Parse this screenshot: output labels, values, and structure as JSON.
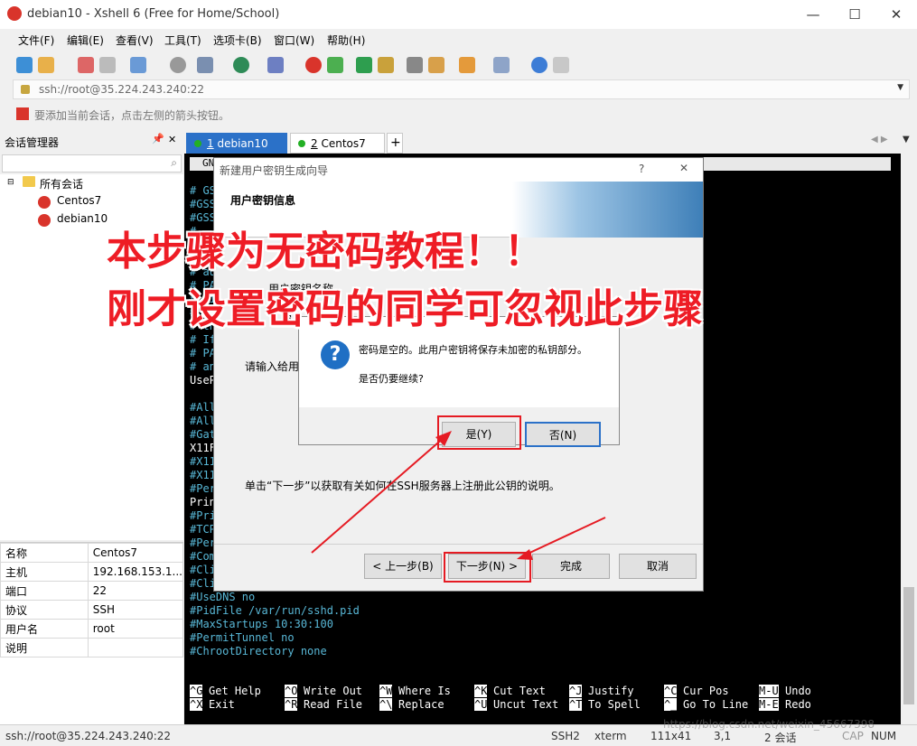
{
  "window": {
    "title": "debian10 - Xshell 6 (Free for Home/School)",
    "minimize": "—",
    "maximize": "☐",
    "close": "✕"
  },
  "menu": [
    "文件(F)",
    "编辑(E)",
    "查看(V)",
    "工具(T)",
    "选项卡(B)",
    "窗口(W)",
    "帮助(H)"
  ],
  "address": {
    "value": "ssh://root@35.224.243.240:22"
  },
  "hint": {
    "text": "要添加当前会话，点击左侧的箭头按钮。"
  },
  "sessions": {
    "header": "会话管理器",
    "pin": "ᅟ",
    "close": "✕",
    "root": "所有会话",
    "items": [
      "Centos7",
      "debian10"
    ]
  },
  "properties": [
    {
      "k": "名称",
      "v": "Centos7"
    },
    {
      "k": "主机",
      "v": "192.168.153.1..."
    },
    {
      "k": "端口",
      "v": "22"
    },
    {
      "k": "协议",
      "v": "SSH"
    },
    {
      "k": "用户名",
      "v": "root"
    },
    {
      "k": "说明",
      "v": ""
    }
  ],
  "tabs": [
    {
      "num": "1",
      "label": "debian10"
    },
    {
      "num": "2",
      "label": "Centos7"
    }
  ],
  "terminal": {
    "header": "GN",
    "lines": [
      {
        "t": "# GS",
        "w": false
      },
      {
        "t": "#GSS",
        "w": false
      },
      {
        "t": "#GSS",
        "w": false
      },
      {
        "t": "#",
        "w": false
      },
      {
        "t": "",
        "w": false
      },
      {
        "t": "# Se",
        "w": false
      },
      {
        "t": "# au",
        "w": false
      },
      {
        "t": "# PA",
        "w": false
      },
      {
        "t": "# wi",
        "w": false
      },
      {
        "t": "# PA",
        "w": false
      },
      {
        "t": "# th",
        "w": false
      },
      {
        "t": "# If",
        "w": false
      },
      {
        "t": "# PA",
        "w": false
      },
      {
        "t": "# an",
        "w": false
      },
      {
        "t": "UseP",
        "w": true
      },
      {
        "t": "",
        "w": false
      },
      {
        "t": "#All",
        "w": false
      },
      {
        "t": "#All",
        "w": false
      },
      {
        "t": "#Gat",
        "w": false
      },
      {
        "t": "X11F",
        "w": true
      },
      {
        "t": "#X11",
        "w": false
      },
      {
        "t": "#X11",
        "w": false
      },
      {
        "t": "#Per",
        "w": false
      },
      {
        "t": "Prin",
        "w": true
      },
      {
        "t": "#Pri",
        "w": false
      },
      {
        "t": "#TCP",
        "w": false
      },
      {
        "t": "#Per",
        "w": false
      },
      {
        "t": "#Com",
        "w": false
      },
      {
        "t": "#Cli",
        "w": false
      },
      {
        "t": "#ClientAliveCountMax 3",
        "w": false
      },
      {
        "t": "#UseDNS no",
        "w": false
      },
      {
        "t": "#PidFile /var/run/sshd.pid",
        "w": false
      },
      {
        "t": "#MaxStartups 10:30:100",
        "w": false
      },
      {
        "t": "#PermitTunnel no",
        "w": false
      },
      {
        "t": "#ChrootDirectory none",
        "w": false
      }
    ],
    "nano": [
      [
        "^G",
        "Get Help",
        "^O",
        "Write Out",
        "^W",
        "Where Is",
        "^K",
        "Cut Text",
        "^J",
        "Justify",
        "^C",
        "Cur Pos",
        "M-U",
        "Undo"
      ],
      [
        "^X",
        "Exit",
        "^R",
        "Read File",
        "^\\",
        "Replace",
        "^U",
        "Uncut Text",
        "^T",
        "To Spell",
        "^_",
        "Go To Line",
        "M-E",
        "Redo"
      ]
    ]
  },
  "wizard": {
    "title": "新建用户密钥生成向导",
    "help": "?",
    "close": "✕",
    "heading": "用户密钥信息",
    "frag1": "用户密钥名称",
    "frag2": "密",
    "prompt": "请输入给用",
    "footer_note": "单击“下一步”以获取有关如何在SSH服务器上注册此公钥的说明。",
    "back": "< 上一步(B)",
    "next": "下一步(N) >",
    "finish": "完成",
    "cancel": "取消"
  },
  "msgbox": {
    "icon": "?",
    "line1": "密码是空的。此用户密钥将保存未加密的私钥部分。",
    "line2": "是否仍要继续?",
    "yes": "是(Y)",
    "no": "否(N)"
  },
  "overlay": {
    "line1": "本步骤为无密码教程！！",
    "line2": "刚才设置密码的同学可忽视此步骤"
  },
  "status": {
    "left": "ssh://root@35.224.243.240:22",
    "proto": "SSH2",
    "term": "xterm",
    "size": "111x41",
    "pos": "3,1",
    "sessions": "2 会话",
    "cap": "CAP",
    "num": "NUM",
    "watermark": "https://blog.csdn.net/weixin_45667398"
  },
  "colors": {
    "accent": "#2b71c8",
    "annotation": "#e51b23",
    "term_text": "#58b7d6"
  }
}
